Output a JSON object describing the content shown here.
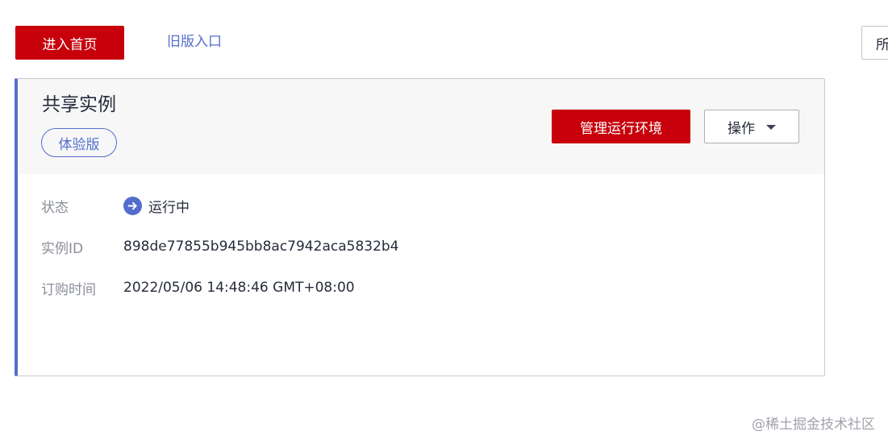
{
  "toolbar": {
    "home_label": "进入首页",
    "old_version_label": "旧版入口",
    "right_select_label": "所"
  },
  "instance": {
    "title": "共享实例",
    "edition": "体验版",
    "manage_label": "管理运行环境",
    "operations_label": "操作",
    "status_label": "状态",
    "status_value": "运行中",
    "id_label": "实例ID",
    "id_value": "898de77855b945bb8ac7942aca5832b4",
    "order_time_label": "订购时间",
    "order_time_value": "2022/05/06 14:48:46 GMT+08:00"
  },
  "watermark": "@稀土掘金技术社区",
  "icons": {
    "status": "arrow-right-circle-icon",
    "operations": "caret-down-icon"
  },
  "colors": {
    "primary": "#c7000b",
    "accent": "#526ecc",
    "header_bg": "#f7f7f7",
    "text": "#252b3a",
    "label": "#8a8e99"
  }
}
